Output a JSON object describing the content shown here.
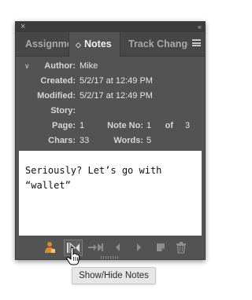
{
  "titlebar": {
    "close_glyph": "×",
    "collapse_glyph": "‹‹"
  },
  "tabs": [
    {
      "label": "Assignments",
      "active": false
    },
    {
      "label": "Notes",
      "active": true,
      "icon": "diamond-arrows-icon"
    },
    {
      "label": "Track Changes",
      "active": false
    }
  ],
  "info": {
    "author_label": "Author:",
    "author": "Mike",
    "created_label": "Created:",
    "created": "5/2/17 at 12:49 PM",
    "modified_label": "Modified:",
    "modified": "5/2/17 at 12:49 PM",
    "story_label": "Story:",
    "story": "",
    "page_label": "Page:",
    "page": "1",
    "note_no_label": "Note No:",
    "note_no": "1",
    "of_label": "of",
    "of_total": "3",
    "chars_label": "Chars:",
    "chars": "33",
    "words_label": "Words:",
    "words": "5"
  },
  "note": {
    "text": "Seriously? Let’s go with\n“wallet”"
  },
  "toolbar": {
    "buttons": [
      {
        "name": "new-note-user-icon",
        "enabled": true
      },
      {
        "name": "show-hide-notes-icon",
        "enabled": true
      },
      {
        "name": "go-to-note-anchor-icon",
        "enabled": false
      },
      {
        "name": "previous-note-icon",
        "enabled": false
      },
      {
        "name": "next-note-icon",
        "enabled": false
      },
      {
        "name": "new-note-icon",
        "enabled": false
      },
      {
        "name": "delete-note-icon",
        "enabled": false
      }
    ]
  },
  "tooltip": {
    "text": "Show/Hide Notes"
  },
  "colors": {
    "panel_bg": "#535353",
    "tabbar_bg": "#474747",
    "accent_orange": "#e08a2e"
  }
}
